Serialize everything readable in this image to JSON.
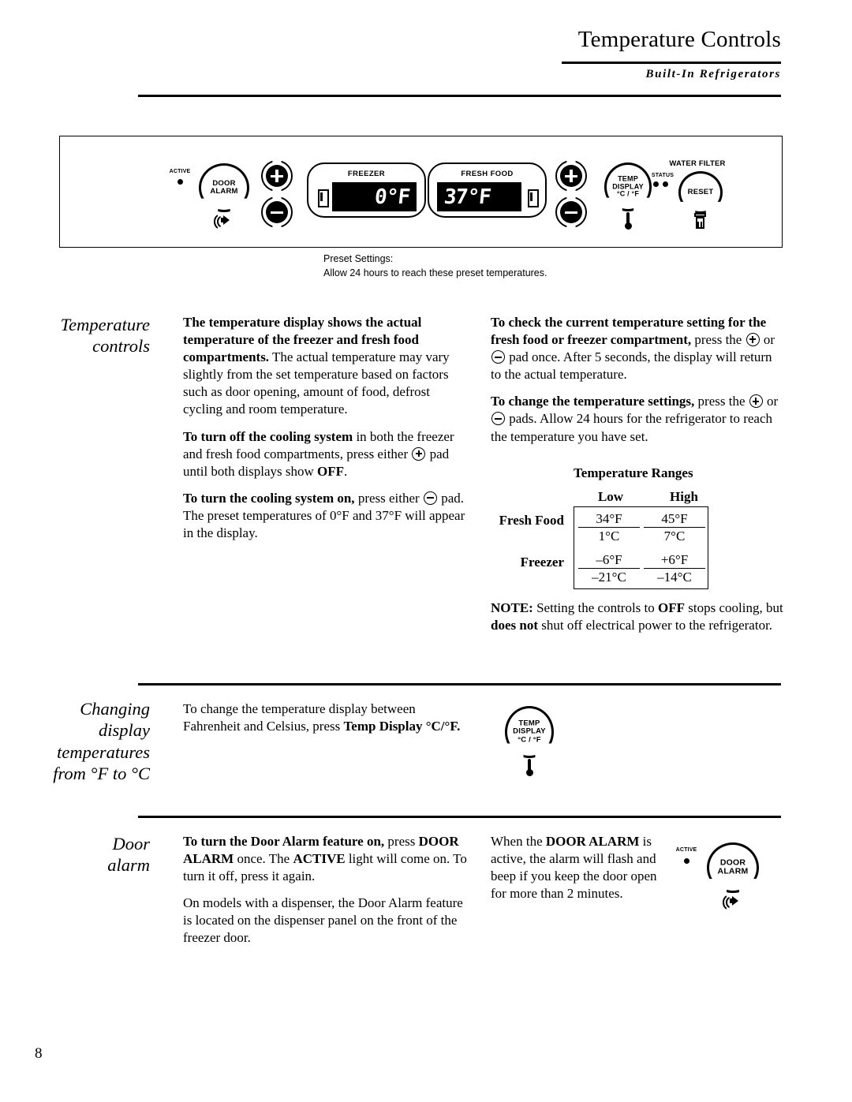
{
  "header": {
    "title": "Temperature Controls",
    "subtitle": "Built-In Refrigerators"
  },
  "control_panel": {
    "active_label": "ACTIVE",
    "door_alarm_label_line1": "DOOR",
    "door_alarm_label_line2": "ALARM",
    "freezer_caption": "FREEZER",
    "freezer_value": "0°F",
    "fresh_food_caption": "FRESH FOOD",
    "fresh_food_value": "37°F",
    "temp_display_line1": "TEMP",
    "temp_display_line2": "DISPLAY",
    "temp_display_line3": "°C / °F",
    "water_filter_label": "WATER FILTER",
    "status_label": "STATUS",
    "reset_label": "RESET"
  },
  "caption": {
    "line1": "Preset Settings:",
    "line2": "Allow 24 hours to reach these preset temperatures."
  },
  "sections": {
    "temperature_controls": {
      "heading_line1": "Temperature",
      "heading_line2": "controls",
      "left_col": {
        "p1_bold": "The temperature display shows the actual temperature of the freezer and fresh food compartments.",
        "p1_rest": " The actual temperature may vary slightly from the set temperature based on factors such as door opening, amount of food, defrost cycling and room temperature.",
        "p2_bold": "To turn off the cooling system",
        "p2_mid": " in both the freezer and fresh food compartments, press either ",
        "p2_after_pad": " pad until both displays show ",
        "p2_off": "OFF",
        "p2_end": ".",
        "p3_bold": "To turn the cooling system on,",
        "p3_mid": " press either ",
        "p3_end": " pad. The preset temperatures of 0°F and 37°F will appear in the display."
      },
      "right_col": {
        "p1_bold": "To check the current temperature setting for the fresh food or freezer compartment,",
        "p1_mid": " press the ",
        "p1_or": " or ",
        "p1_end": " pad once. After 5 seconds, the display will return to the actual temperature.",
        "p2_bold": "To change the temperature settings,",
        "p2_mid": " press the ",
        "p2_or": " or ",
        "p2_end": " pads. Allow 24 hours for the refrigerator to reach the temperature you have set.",
        "note_label": "NOTE:",
        "note_1": " Setting the controls to ",
        "note_off": "OFF",
        "note_2": " stops cooling, but ",
        "note_doesnot": "does not",
        "note_3": " shut off electrical power to the refrigerator."
      },
      "table": {
        "title": "Temperature Ranges",
        "col_headers": [
          "Low",
          "High"
        ],
        "rows": [
          {
            "label": "Fresh Food",
            "cells": [
              {
                "f": "34°F",
                "c": "1°C"
              },
              {
                "f": "45°F",
                "c": "7°C"
              }
            ]
          },
          {
            "label": "Freezer",
            "cells": [
              {
                "f": "–6°F",
                "c": "–21°C"
              },
              {
                "f": "+6°F",
                "c": "–14°C"
              }
            ]
          }
        ]
      }
    },
    "changing_display": {
      "heading_line1": "Changing",
      "heading_line2": "display",
      "heading_line3": "temperatures",
      "heading_line4": "from °F to °C",
      "body_1": "To change the temperature display between Fahrenheit and Celsius, press ",
      "body_bold": "Temp Display °C/°F."
    },
    "door_alarm": {
      "heading_line1": "Door",
      "heading_line2": "alarm",
      "left_col": {
        "p1_bold": "To turn the Door Alarm feature on,",
        "p1_mid": " press ",
        "p1_b2": "DOOR ALARM",
        "p1_mid2": " once. The ",
        "p1_b3": "ACTIVE",
        "p1_end": " light will come on. To turn it off, press it again.",
        "p2": "On models with a dispenser, the Door Alarm feature is located on the dispenser panel on the front of the freezer door."
      },
      "right_col": {
        "t1": "When the ",
        "t_bold": "DOOR ALARM",
        "t2": " is active, the alarm will flash and beep if you keep the door open for more than 2 minutes."
      }
    }
  },
  "footer": {
    "page_number": "8"
  }
}
